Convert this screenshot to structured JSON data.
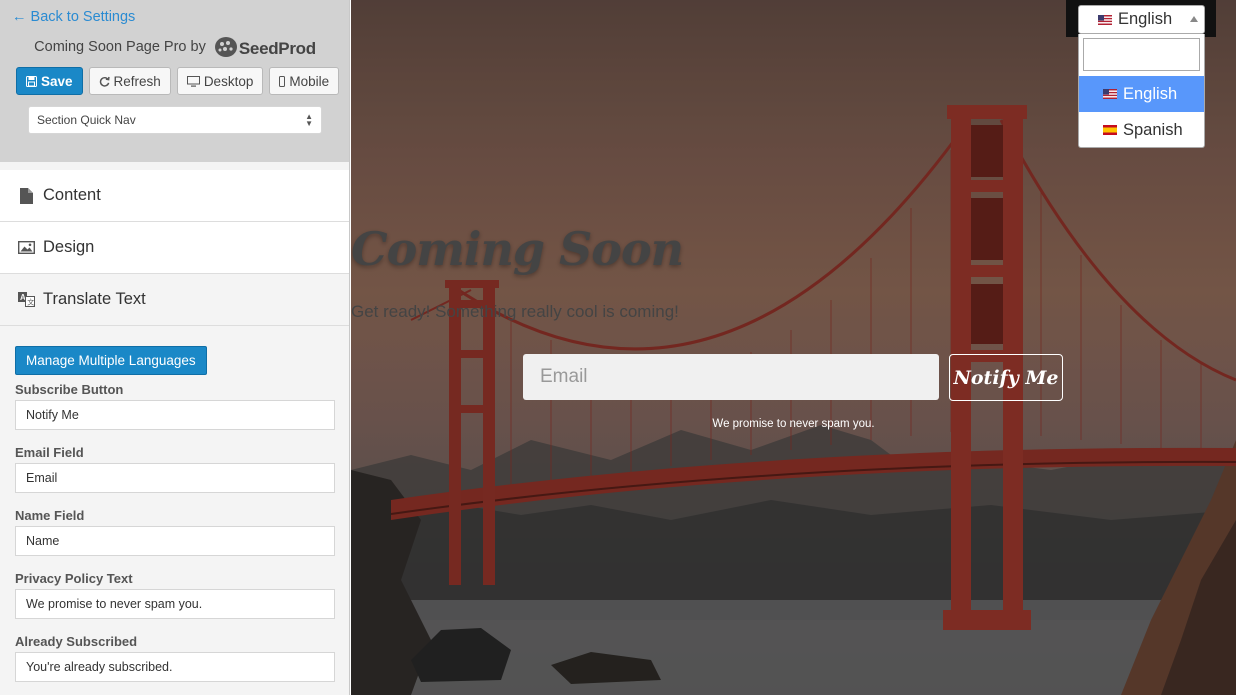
{
  "sidebar": {
    "back_link": "← Back to Settings",
    "brand_text": "Coming Soon Page Pro by",
    "brand_logo": "SeedProd",
    "toolbar": {
      "save": "Save",
      "refresh": "Refresh",
      "desktop": "Desktop",
      "mobile": "Mobile"
    },
    "quick_nav": "Section Quick Nav",
    "sections": [
      {
        "label": "Content",
        "icon": "file-icon"
      },
      {
        "label": "Design",
        "icon": "image-icon"
      },
      {
        "label": "Translate Text",
        "icon": "translate-icon"
      }
    ],
    "manage_languages": "Manage Multiple Languages",
    "fields": [
      {
        "label": "Subscribe Button",
        "value": "Notify Me"
      },
      {
        "label": "Email Field",
        "value": "Email"
      },
      {
        "label": "Name Field",
        "value": "Name"
      },
      {
        "label": "Privacy Policy Text",
        "value": "We promise to never spam you."
      },
      {
        "label": "Already Subscribed",
        "value": "You're already subscribed."
      }
    ]
  },
  "preview": {
    "title": "Coming Soon",
    "subtitle": "Get ready! Something really cool is coming!",
    "email_placeholder": "Email",
    "notify_button": "Notify Me",
    "privacy": "We promise to never spam you.",
    "language": {
      "selected": "English",
      "options": [
        "English",
        "Spanish"
      ]
    }
  },
  "colors": {
    "accent": "#1a88c7",
    "link": "#2a8bd2",
    "dropdown_highlight": "#5897fb"
  }
}
